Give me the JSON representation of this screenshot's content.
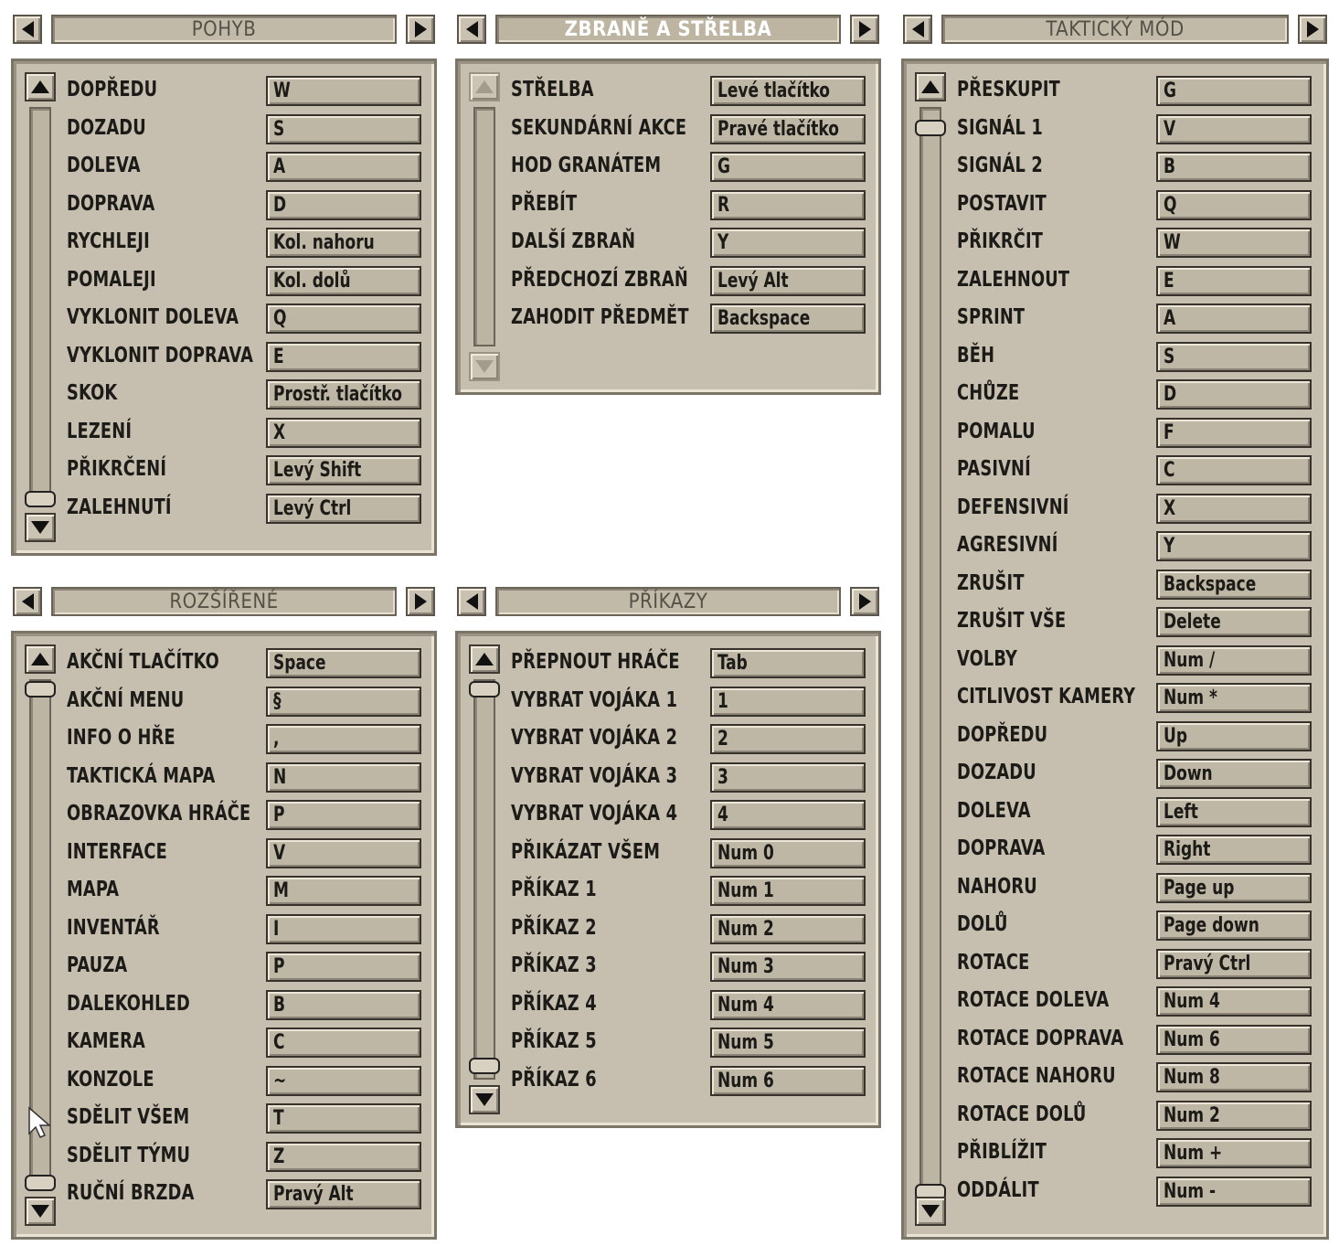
{
  "panels": {
    "pohyb": {
      "title": "POHYB",
      "rows": [
        {
          "action": "DOPŘEDU",
          "key": "W"
        },
        {
          "action": "DOZADU",
          "key": "S"
        },
        {
          "action": "DOLEVA",
          "key": "A"
        },
        {
          "action": "DOPRAVA",
          "key": "D"
        },
        {
          "action": "RYCHLEJI",
          "key": "Kol. nahoru"
        },
        {
          "action": "POMALEJI",
          "key": "Kol. dolů"
        },
        {
          "action": "VYKLONIT DOLEVA",
          "key": "Q"
        },
        {
          "action": "VYKLONIT DOPRAVA",
          "key": "E"
        },
        {
          "action": "SKOK",
          "key": "Prostř. tlačítko"
        },
        {
          "action": "LEZENÍ",
          "key": "X"
        },
        {
          "action": "PŘIKRČENÍ",
          "key": "Levý Shift"
        },
        {
          "action": "ZALEHNUTÍ",
          "key": "Levý Ctrl"
        }
      ]
    },
    "zbrane": {
      "title": "ZBRANĚ A STŘELBA",
      "rows": [
        {
          "action": "STŘELBA",
          "key": "Levé tlačítko"
        },
        {
          "action": "SEKUNDÁRNÍ AKCE",
          "key": "Pravé tlačítko"
        },
        {
          "action": "HOD GRANÁTEM",
          "key": "G"
        },
        {
          "action": "PŘEBÍT",
          "key": "R"
        },
        {
          "action": "DALŠÍ ZBRAŇ",
          "key": "Y"
        },
        {
          "action": "PŘEDCHOZÍ ZBRAŇ",
          "key": "Levý Alt"
        },
        {
          "action": "ZAHODIT PŘEDMĚT",
          "key": "Backspace"
        }
      ]
    },
    "takticky": {
      "title": "TAKTICKÝ MÓD",
      "rows": [
        {
          "action": "PŘESKUPIT",
          "key": "G"
        },
        {
          "action": "SIGNÁL 1",
          "key": "V"
        },
        {
          "action": "SIGNÁL 2",
          "key": "B"
        },
        {
          "action": "POSTAVIT",
          "key": "Q"
        },
        {
          "action": "PŘIKRČIT",
          "key": "W"
        },
        {
          "action": "ZALEHNOUT",
          "key": "E"
        },
        {
          "action": "SPRINT",
          "key": "A"
        },
        {
          "action": "BĚH",
          "key": "S"
        },
        {
          "action": "CHŮZE",
          "key": "D"
        },
        {
          "action": "POMALU",
          "key": "F"
        },
        {
          "action": "PASIVNÍ",
          "key": "C"
        },
        {
          "action": "DEFENSIVNÍ",
          "key": "X"
        },
        {
          "action": "AGRESIVNÍ",
          "key": "Y"
        },
        {
          "action": "ZRUŠIT",
          "key": "Backspace"
        },
        {
          "action": "ZRUŠIT VŠE",
          "key": "Delete"
        },
        {
          "action": "VOLBY",
          "key": "Num /"
        },
        {
          "action": "CITLIVOST KAMERY",
          "key": "Num *"
        },
        {
          "action": "DOPŘEDU",
          "key": "Up"
        },
        {
          "action": "DOZADU",
          "key": "Down"
        },
        {
          "action": "DOLEVA",
          "key": "Left"
        },
        {
          "action": "DOPRAVA",
          "key": "Right"
        },
        {
          "action": "NAHORU",
          "key": "Page up"
        },
        {
          "action": "DOLŮ",
          "key": "Page down"
        },
        {
          "action": "ROTACE",
          "key": "Pravý Ctrl"
        },
        {
          "action": "ROTACE DOLEVA",
          "key": "Num 4"
        },
        {
          "action": "ROTACE DOPRAVA",
          "key": "Num 6"
        },
        {
          "action": "ROTACE NAHORU",
          "key": "Num 8"
        },
        {
          "action": "ROTACE DOLŮ",
          "key": "Num 2"
        },
        {
          "action": "PŘIBLÍŽIT",
          "key": "Num +"
        },
        {
          "action": "ODDÁLIT",
          "key": "Num -"
        }
      ]
    },
    "rozsirene": {
      "title": "ROZŠÍŘENÉ",
      "rows": [
        {
          "action": "AKČNÍ TLAČÍTKO",
          "key": "Space"
        },
        {
          "action": "AKČNÍ MENU",
          "key": "§"
        },
        {
          "action": "INFO O HŘE",
          "key": ","
        },
        {
          "action": "TAKTICKÁ MAPA",
          "key": "N"
        },
        {
          "action": "OBRAZOVKA HRÁČE",
          "key": "P"
        },
        {
          "action": "INTERFACE",
          "key": "V"
        },
        {
          "action": "MAPA",
          "key": "M"
        },
        {
          "action": "INVENTÁŘ",
          "key": "I"
        },
        {
          "action": "PAUZA",
          "key": "P"
        },
        {
          "action": "DALEKOHLED",
          "key": "B"
        },
        {
          "action": "KAMERA",
          "key": "C"
        },
        {
          "action": "KONZOLE",
          "key": "~"
        },
        {
          "action": "SDĚLIT VŠEM",
          "key": "T"
        },
        {
          "action": "SDĚLIT TÝMU",
          "key": "Z"
        },
        {
          "action": "RUČNÍ BRZDA",
          "key": "Pravý Alt"
        }
      ]
    },
    "prikazy": {
      "title": "PŘÍKAZY",
      "rows": [
        {
          "action": "PŘEPNOUT HRÁČE",
          "key": "Tab"
        },
        {
          "action": "VYBRAT VOJÁKA 1",
          "key": "1"
        },
        {
          "action": "VYBRAT VOJÁKA 2",
          "key": "2"
        },
        {
          "action": "VYBRAT VOJÁKA 3",
          "key": "3"
        },
        {
          "action": "VYBRAT VOJÁKA 4",
          "key": "4"
        },
        {
          "action": "PŘIKÁZAT VŠEM",
          "key": "Num 0"
        },
        {
          "action": "PŘÍKAZ 1",
          "key": "Num 1"
        },
        {
          "action": "PŘÍKAZ 2",
          "key": "Num 2"
        },
        {
          "action": "PŘÍKAZ 3",
          "key": "Num 3"
        },
        {
          "action": "PŘÍKAZ 4",
          "key": "Num 4"
        },
        {
          "action": "PŘÍKAZ 5",
          "key": "Num 5"
        },
        {
          "action": "PŘÍKAZ 6",
          "key": "Num 6"
        }
      ]
    }
  },
  "icons": {
    "prev": "arrow-left-icon",
    "next": "arrow-right-icon",
    "scroll_up": "arrow-up-icon",
    "scroll_down": "arrow-down-icon",
    "cursor": "mouse-cursor-icon"
  },
  "colors": {
    "panel_bg": "#c6bfaf",
    "key_bg": "#bfb7a6",
    "text": "#1d1b18",
    "active_title": "#ffffff",
    "inactive_title": "#555047"
  }
}
